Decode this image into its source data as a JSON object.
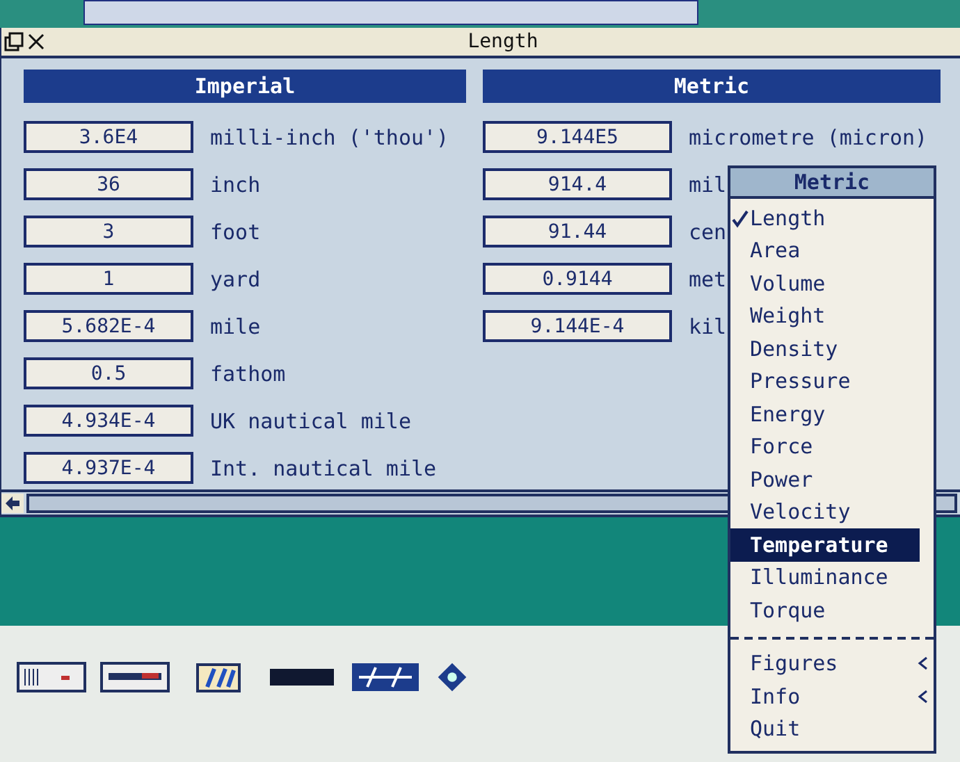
{
  "window": {
    "title": "Length"
  },
  "columns": [
    {
      "heading": "Imperial",
      "rows": [
        {
          "value": "3.6E4",
          "unit": "milli-inch ('thou')"
        },
        {
          "value": "36",
          "unit": "inch"
        },
        {
          "value": "3",
          "unit": "foot"
        },
        {
          "value": "1",
          "unit": "yard"
        },
        {
          "value": "5.682E-4",
          "unit": "mile"
        },
        {
          "value": "0.5",
          "unit": "fathom"
        },
        {
          "value": "4.934E-4",
          "unit": "UK nautical mile"
        },
        {
          "value": "4.937E-4",
          "unit": "Int. nautical mile"
        }
      ]
    },
    {
      "heading": "Metric",
      "rows": [
        {
          "value": "9.144E5",
          "unit": "micrometre (micron)"
        },
        {
          "value": "914.4",
          "unit": "mil"
        },
        {
          "value": "91.44",
          "unit": "cen"
        },
        {
          "value": "0.9144",
          "unit": "met"
        },
        {
          "value": "9.144E-4",
          "unit": "kil"
        }
      ]
    }
  ],
  "menu": {
    "title": "Metric",
    "groups": [
      [
        {
          "label": "Length",
          "kind": "item",
          "checked": true,
          "selected": false
        },
        {
          "label": "Area",
          "kind": "item",
          "checked": false,
          "selected": false
        },
        {
          "label": "Volume",
          "kind": "item",
          "checked": false,
          "selected": false
        },
        {
          "label": "Weight",
          "kind": "item",
          "checked": false,
          "selected": false
        },
        {
          "label": "Density",
          "kind": "item",
          "checked": false,
          "selected": false
        },
        {
          "label": "Pressure",
          "kind": "item",
          "checked": false,
          "selected": false
        },
        {
          "label": "Energy",
          "kind": "item",
          "checked": false,
          "selected": false
        },
        {
          "label": "Force",
          "kind": "item",
          "checked": false,
          "selected": false
        },
        {
          "label": "Power",
          "kind": "item",
          "checked": false,
          "selected": false
        },
        {
          "label": "Velocity",
          "kind": "item",
          "checked": false,
          "selected": false
        },
        {
          "label": "Temperature",
          "kind": "item",
          "checked": false,
          "selected": true
        },
        {
          "label": "Illuminance",
          "kind": "item",
          "checked": false,
          "selected": false
        },
        {
          "label": "Torque",
          "kind": "item",
          "checked": false,
          "selected": false
        }
      ],
      [
        {
          "label": "Figures",
          "kind": "submenu",
          "checked": false,
          "selected": false
        },
        {
          "label": "Info",
          "kind": "submenu",
          "checked": false,
          "selected": false
        },
        {
          "label": "Quit",
          "kind": "item",
          "checked": false,
          "selected": false
        }
      ]
    ]
  }
}
